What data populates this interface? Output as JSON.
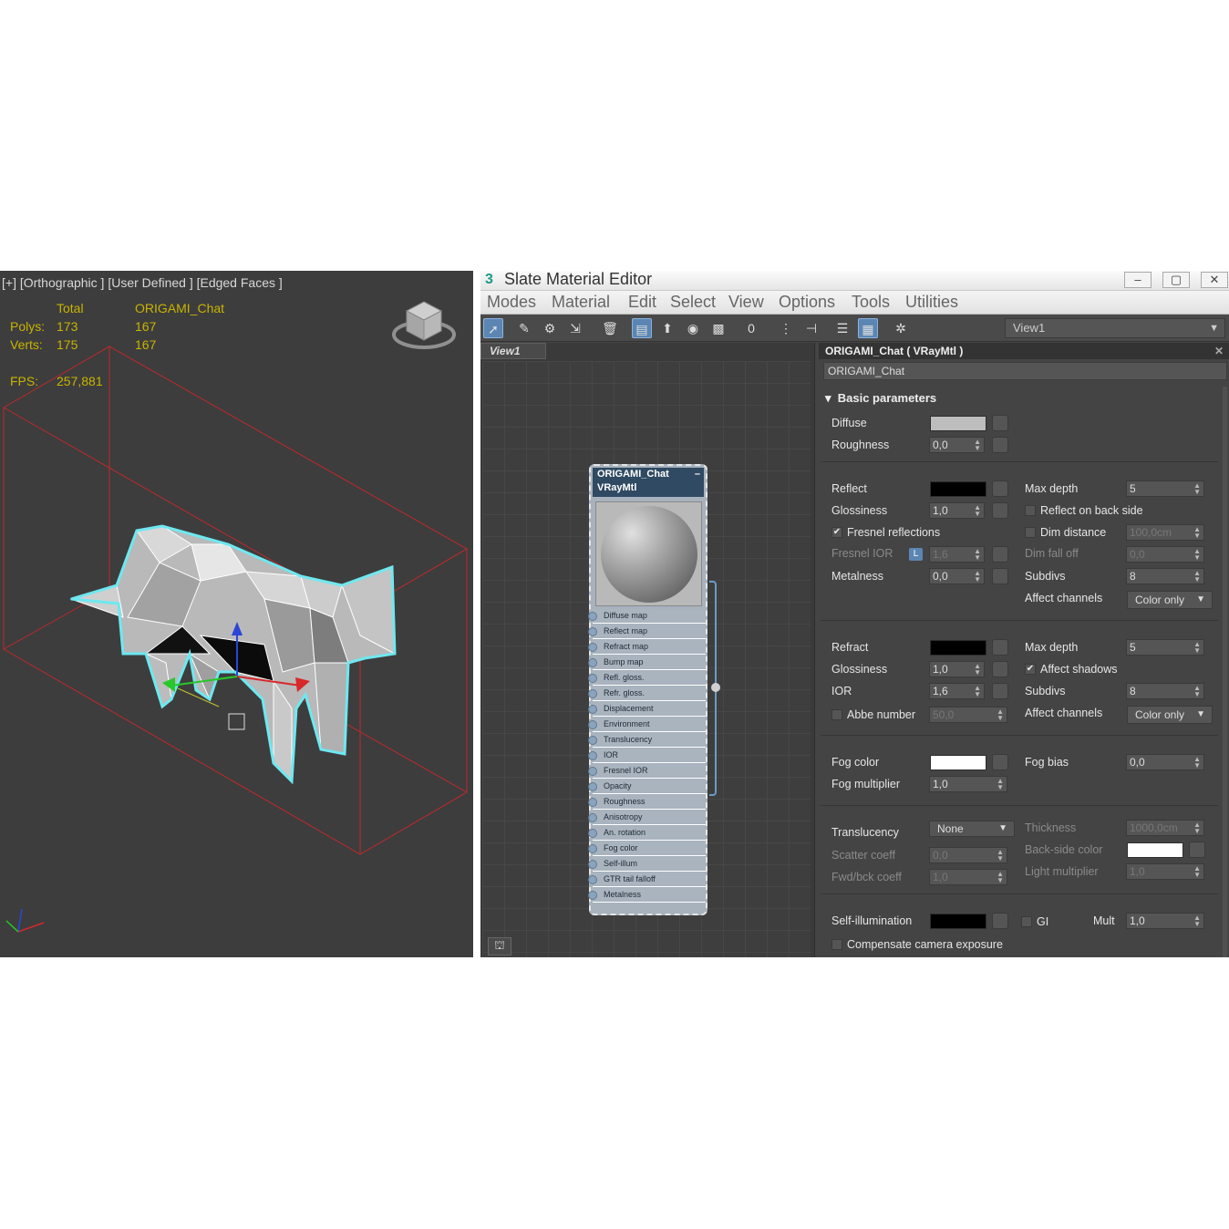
{
  "viewport": {
    "label": "[+] [Orthographic ] [User Defined ] [Edged Faces ]",
    "stats": {
      "total_header": "Total",
      "object_header": "ORIGAMI_Chat",
      "polys_label": "Polys:",
      "polys_total": "173",
      "polys_object": "167",
      "verts_label": "Verts:",
      "verts_total": "175",
      "verts_object": "167",
      "fps_label": "FPS:",
      "fps_value": "257,881"
    },
    "colors": {
      "stats_text": "#c8b400",
      "bounding_box": "#c0282a",
      "selection_outline": "#6ee8f0"
    }
  },
  "editor": {
    "title": "Slate Material Editor",
    "menu": [
      "Modes",
      "Material",
      "Edit",
      "Select",
      "View",
      "Options",
      "Tools",
      "Utilities"
    ],
    "view_select": "View1",
    "view_tab": "View1",
    "node": {
      "title_line1": "ORIGAMI_Chat",
      "title_line2": "VRayMtl",
      "slots": [
        "Diffuse map",
        "Reflect map",
        "Refract map",
        "Bump map",
        "Refl. gloss.",
        "Refr. gloss.",
        "Displacement",
        "Environment",
        "Translucency",
        "IOR",
        "Fresnel IOR",
        "Opacity",
        "Roughness",
        "Anisotropy",
        "An. rotation",
        "Fog color",
        "Self-illum",
        "GTR tail falloff",
        "Metalness"
      ]
    },
    "props": {
      "header": "ORIGAMI_Chat  ( VRayMtl )",
      "name": "ORIGAMI_Chat",
      "rollout": "Basic parameters",
      "diffuse": {
        "label": "Diffuse",
        "color": "#bdbdbd"
      },
      "roughness": {
        "label": "Roughness",
        "value": "0,0"
      },
      "reflect": {
        "label": "Reflect",
        "color": "#000000"
      },
      "refl_glossiness": {
        "label": "Glossiness",
        "value": "1,0"
      },
      "fresnel": {
        "label": "Fresnel reflections",
        "checked": "✔"
      },
      "fresnel_ior": {
        "label": "Fresnel IOR",
        "lock": "L",
        "value": "1,6"
      },
      "metalness": {
        "label": "Metalness",
        "value": "0,0"
      },
      "refl_max_depth": {
        "label": "Max depth",
        "value": "5"
      },
      "reflect_back": {
        "label": "Reflect on back side"
      },
      "dim_distance": {
        "label": "Dim distance",
        "value": "100,0cm"
      },
      "dim_falloff": {
        "label": "Dim fall off",
        "value": "0,0"
      },
      "refl_subdivs": {
        "label": "Subdivs",
        "value": "8"
      },
      "refl_affect": {
        "label": "Affect channels",
        "value": "Color only"
      },
      "refract": {
        "label": "Refract",
        "color": "#000000"
      },
      "refr_glossiness": {
        "label": "Glossiness",
        "value": "1,0"
      },
      "ior": {
        "label": "IOR",
        "value": "1,6"
      },
      "abbe": {
        "label": "Abbe number",
        "value": "50,0"
      },
      "refr_max_depth": {
        "label": "Max depth",
        "value": "5"
      },
      "affect_shadows": {
        "label": "Affect shadows",
        "checked": "✔"
      },
      "refr_subdivs": {
        "label": "Subdivs",
        "value": "8"
      },
      "refr_affect": {
        "label": "Affect channels",
        "value": "Color only"
      },
      "fog_color": {
        "label": "Fog color",
        "color": "#ffffff"
      },
      "fog_mult": {
        "label": "Fog multiplier",
        "value": "1,0"
      },
      "fog_bias": {
        "label": "Fog bias",
        "value": "0,0"
      },
      "translucency": {
        "label": "Translucency",
        "value": "None"
      },
      "scatter": {
        "label": "Scatter coeff",
        "value": "0,0"
      },
      "fwd_bck": {
        "label": "Fwd/bck coeff",
        "value": "1,0"
      },
      "thickness": {
        "label": "Thickness",
        "value": "1000,0cm"
      },
      "back_side_color": {
        "label": "Back-side color",
        "color": "#ffffff"
      },
      "light_mult": {
        "label": "Light multiplier",
        "value": "1,0"
      },
      "self_illum": {
        "label": "Self-illumination",
        "color": "#000000"
      },
      "gi": {
        "label": "GI"
      },
      "mult": {
        "label": "Mult",
        "value": "1,0"
      },
      "compensate": {
        "label": "Compensate camera exposure"
      }
    },
    "colors": {
      "accent": "#5b86b3",
      "node_header": "#2f4a62",
      "panel_bg": "#444444"
    }
  }
}
